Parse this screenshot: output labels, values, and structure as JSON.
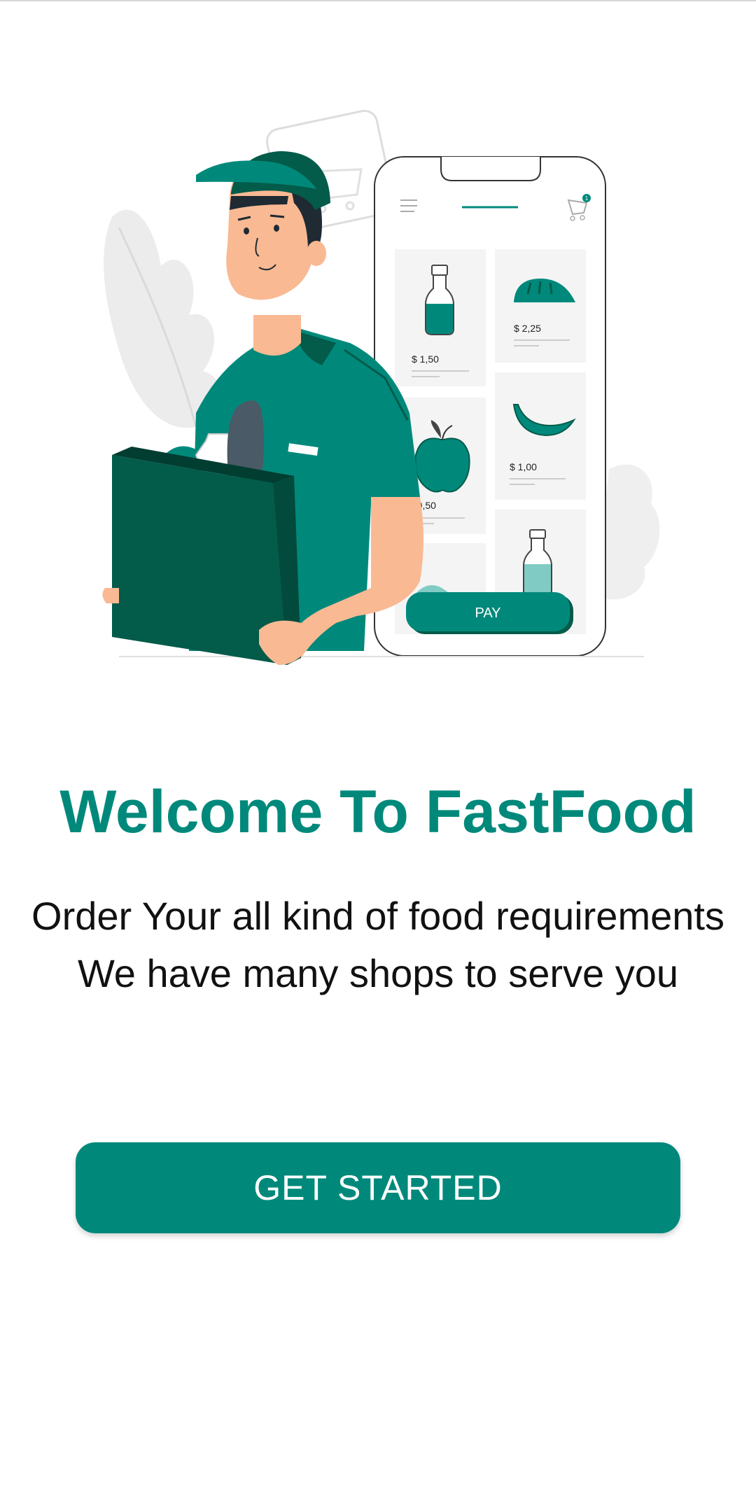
{
  "hero": {
    "illustration": "delivery-person-with-grocery-bag-and-shop-app",
    "app_mock": {
      "cart_badge": "1",
      "prices": [
        "$ 1,50",
        "$ 2,25",
        "$ 0,50",
        "$ 1,00"
      ],
      "pay_label": "PAY"
    }
  },
  "welcome": {
    "title": "Welcome To FastFood",
    "line1": "Order Your all kind of food requirements",
    "line2": "We have many shops to serve you"
  },
  "cta": {
    "label": "GET STARTED"
  },
  "colors": {
    "accent": "#00897B",
    "dark_green": "#035B49",
    "text": "#111111"
  }
}
